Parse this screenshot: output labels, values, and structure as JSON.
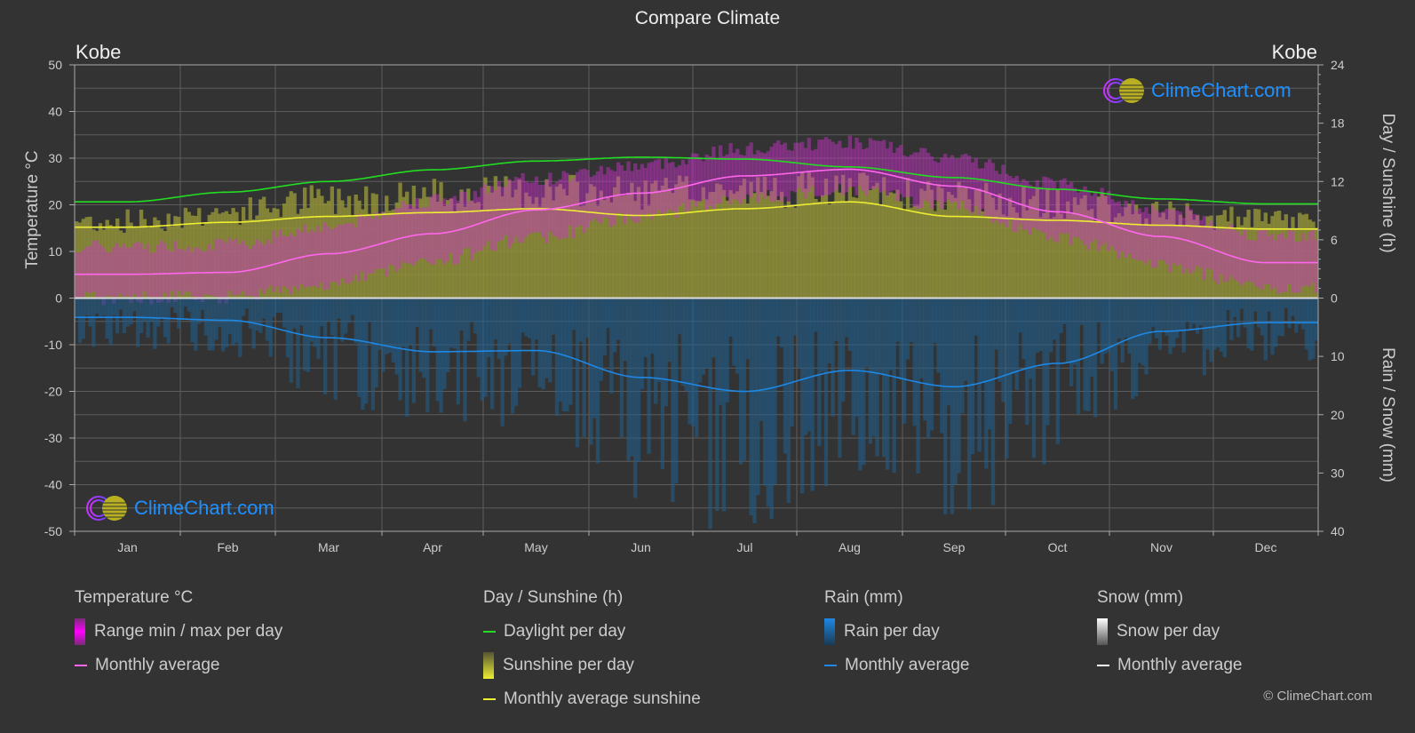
{
  "title": "Compare Climate",
  "city_left": "Kobe",
  "city_right": "Kobe",
  "axis_left_title": "Temperature °C",
  "axis_right_top_title": "Day / Sunshine (h)",
  "axis_right_bottom_title": "Rain / Snow (mm)",
  "logo_text": "ClimeChart.com",
  "copyright": "© ClimeChart.com",
  "colors": {
    "background": "#333333",
    "daylight": "#22dd22",
    "sunshine_avg": "#eeee33",
    "sunshine_fill": "#8f8f38",
    "temp_avg": "#ff66ee",
    "temp_range": "#cc33cc",
    "rain_avg": "#1e88e5",
    "rain_fill": "#1f5f8f",
    "snow": "#ffffff",
    "grid": "#5a5a5a",
    "logo_text": "#1e90ff"
  },
  "legend": {
    "temperature": {
      "header": "Temperature °C",
      "range": "Range min / max per day",
      "avg": "Monthly average"
    },
    "sunshine": {
      "header": "Day / Sunshine (h)",
      "daylight": "Daylight per day",
      "sunshine": "Sunshine per day",
      "avg": "Monthly average sunshine"
    },
    "rain": {
      "header": "Rain (mm)",
      "per_day": "Rain per day",
      "avg": "Monthly average"
    },
    "snow": {
      "header": "Snow (mm)",
      "per_day": "Snow per day",
      "avg": "Monthly average"
    }
  },
  "chart_data": {
    "type": "line",
    "title": "Compare Climate",
    "location": "Kobe",
    "categories": [
      "Jan",
      "Feb",
      "Mar",
      "Apr",
      "May",
      "Jun",
      "Jul",
      "Aug",
      "Sep",
      "Oct",
      "Nov",
      "Dec"
    ],
    "axes": {
      "left": {
        "label": "Temperature °C",
        "range": [
          -50,
          50
        ],
        "ticks": [
          50,
          40,
          30,
          20,
          10,
          0,
          -10,
          -20,
          -30,
          -40,
          -50
        ]
      },
      "right_top": {
        "label": "Day / Sunshine (h)",
        "range": [
          0,
          24
        ],
        "ticks": [
          24,
          18,
          12,
          6,
          0
        ]
      },
      "right_bottom": {
        "label": "Rain / Snow (mm)",
        "range": [
          0,
          40
        ],
        "ticks": [
          0,
          10,
          20,
          30,
          40
        ]
      }
    },
    "grid": true,
    "series": [
      {
        "name": "Temperature monthly average",
        "unit": "°C",
        "axis": "left",
        "values": [
          5.1,
          5.5,
          9.5,
          13.8,
          18.9,
          22.5,
          26.2,
          27.6,
          24.0,
          18.5,
          13.2,
          7.6
        ]
      },
      {
        "name": "Temperature daily min (approx.)",
        "unit": "°C",
        "axis": "left",
        "values": [
          1.5,
          1.8,
          4.5,
          9.5,
          14.5,
          19.0,
          23.0,
          24.5,
          21.0,
          14.5,
          8.5,
          3.5
        ]
      },
      {
        "name": "Temperature daily max (approx.)",
        "unit": "°C",
        "axis": "left",
        "values": [
          9.5,
          10.0,
          14.0,
          19.5,
          24.0,
          27.0,
          30.5,
          32.0,
          28.5,
          23.0,
          17.5,
          12.0
        ]
      },
      {
        "name": "Daylight per day",
        "unit": "h",
        "axis": "right_top",
        "values": [
          9.9,
          10.9,
          12.0,
          13.2,
          14.1,
          14.5,
          14.3,
          13.5,
          12.4,
          11.2,
          10.2,
          9.7
        ]
      },
      {
        "name": "Sunshine per day (upper envelope)",
        "unit": "h",
        "axis": "right_top",
        "values": [
          8.8,
          9.8,
          11.3,
          11.8,
          12.2,
          12.0,
          12.3,
          12.4,
          11.5,
          10.8,
          9.5,
          8.8
        ]
      },
      {
        "name": "Monthly average sunshine",
        "unit": "h",
        "axis": "right_top",
        "values": [
          7.3,
          7.8,
          8.4,
          8.8,
          9.2,
          8.5,
          9.2,
          9.9,
          8.4,
          8.0,
          7.5,
          7.1
        ]
      },
      {
        "name": "Rain monthly average",
        "unit": "mm",
        "axis": "right_bottom",
        "values": [
          3.3,
          3.8,
          6.8,
          9.2,
          9.0,
          13.6,
          16.0,
          12.4,
          15.2,
          11.2,
          5.7,
          4.2
        ]
      },
      {
        "name": "Snow monthly average",
        "unit": "mm",
        "axis": "right_bottom",
        "values": [
          0,
          0,
          0,
          0,
          0,
          0,
          0,
          0,
          0,
          0,
          0,
          0
        ]
      }
    ]
  }
}
